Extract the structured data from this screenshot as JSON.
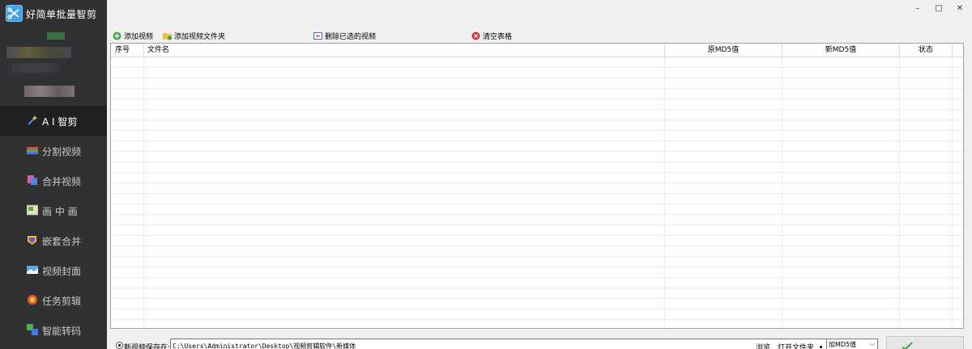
{
  "app": {
    "title": "好简单批量智剪"
  },
  "window_controls": {
    "minimize": "–",
    "maximize": "□",
    "close": "✕"
  },
  "sidebar": {
    "items": [
      {
        "label": "A I 智剪",
        "icon": "wand-icon",
        "active": true
      },
      {
        "label": "分割视频",
        "icon": "split-video-icon",
        "active": false
      },
      {
        "label": "合并视频",
        "icon": "merge-video-icon",
        "active": false
      },
      {
        "label": "画 中 画",
        "icon": "picture-in-picture-icon",
        "active": false
      },
      {
        "label": "嵌套合并",
        "icon": "nested-merge-icon",
        "active": false
      },
      {
        "label": "视频封面",
        "icon": "video-cover-icon",
        "active": false
      },
      {
        "label": "任务剪辑",
        "icon": "task-clip-icon",
        "active": false
      },
      {
        "label": "智能转码",
        "icon": "transcode-icon",
        "active": false
      }
    ]
  },
  "toolbar": {
    "add_video": "添加视频",
    "add_folder": "添加视频文件夹",
    "delete_selected": "删除已选的视频",
    "clear_table": "清空表格"
  },
  "table": {
    "columns": [
      "序号",
      "文件名",
      "原MD5值",
      "新MD5值",
      "状态"
    ],
    "rows": []
  },
  "bottom": {
    "save_label": "新视频保存在:",
    "save_path": "C:\\Users\\Administrator\\Desktop\\视频剪辑软件\\新媒体",
    "browse": "浏览",
    "open_folder": "打开文件夹",
    "mode_value": "加MD5值"
  },
  "colors": {
    "sidebar_bg": "#2f3133",
    "sidebar_active_bg": "#1f2022",
    "accent_green": "#3aa53a",
    "clear_red": "#d93030"
  }
}
